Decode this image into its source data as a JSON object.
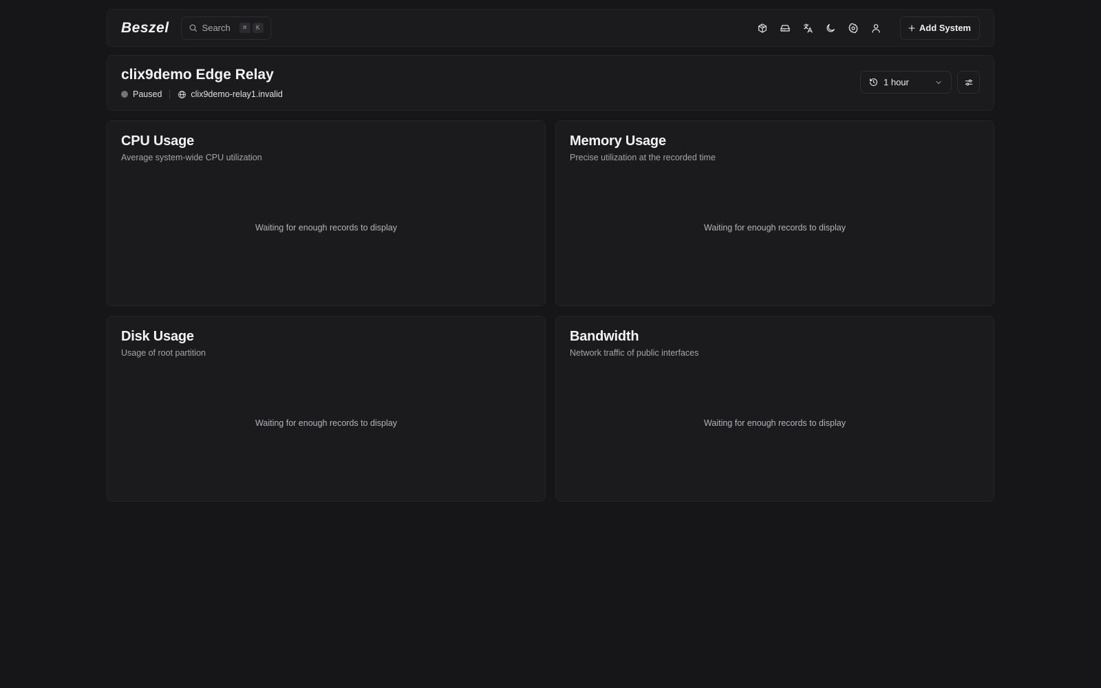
{
  "header": {
    "logo": "Beszel",
    "search": {
      "label": "Search",
      "shortcut": [
        "⌘",
        "K"
      ]
    },
    "icons": [
      "container-icon",
      "hard-drive-icon",
      "language-icon",
      "theme-moon-icon",
      "settings-gear-icon",
      "user-icon"
    ],
    "add_system_label": "Add System"
  },
  "system": {
    "name": "clix9demo Edge Relay",
    "status": "Paused",
    "status_color": "#737378",
    "host": "clix9demo-relay1.invalid",
    "time_range": "1 hour"
  },
  "charts": [
    {
      "title": "CPU Usage",
      "description": "Average system-wide CPU utilization",
      "empty_message": "Waiting for enough records to display"
    },
    {
      "title": "Memory Usage",
      "description": "Precise utilization at the recorded time",
      "empty_message": "Waiting for enough records to display"
    },
    {
      "title": "Disk Usage",
      "description": "Usage of root partition",
      "empty_message": "Waiting for enough records to display"
    },
    {
      "title": "Bandwidth",
      "description": "Network traffic of public interfaces",
      "empty_message": "Waiting for enough records to display"
    }
  ]
}
